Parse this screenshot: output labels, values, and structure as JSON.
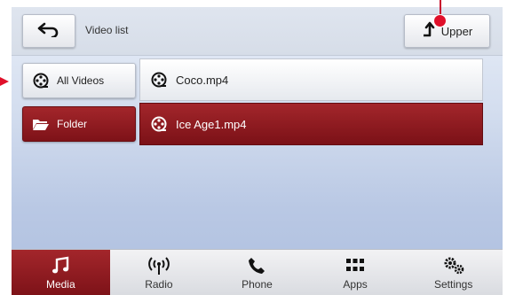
{
  "header": {
    "title": "Video list",
    "upper_label": "Upper"
  },
  "sidebar": {
    "items": [
      {
        "label": "All Videos",
        "icon": "film-reel-icon",
        "selected": false
      },
      {
        "label": "Folder",
        "icon": "folder-icon",
        "selected": true
      }
    ]
  },
  "files": [
    {
      "name": "Coco.mp4",
      "icon": "film-reel-icon",
      "selected": false
    },
    {
      "name": "Ice Age1.mp4",
      "icon": "film-reel-icon",
      "selected": true
    }
  ],
  "bottom_nav": [
    {
      "label": "Media",
      "icon": "music-note-icon",
      "active": true
    },
    {
      "label": "Radio",
      "icon": "radio-antenna-icon",
      "active": false
    },
    {
      "label": "Phone",
      "icon": "phone-icon",
      "active": false
    },
    {
      "label": "Apps",
      "icon": "apps-grid-icon",
      "active": false
    },
    {
      "label": "Settings",
      "icon": "gears-icon",
      "active": false
    }
  ],
  "colors": {
    "accent": "#8e1a20",
    "callout": "#e0102a"
  }
}
